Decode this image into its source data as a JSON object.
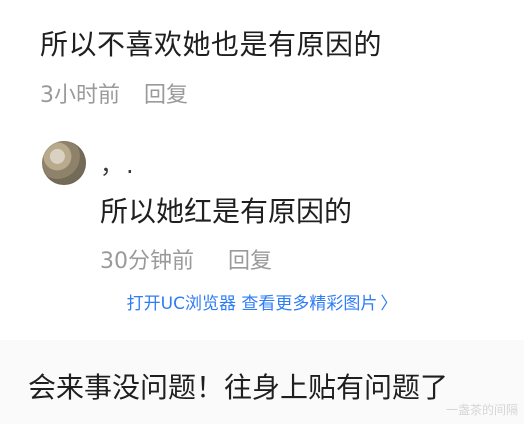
{
  "top_comment": {
    "text": "所以不喜欢她也是有原因的",
    "time": "3小时前",
    "reply_label": "回复"
  },
  "reply": {
    "username": "，.",
    "text": "所以她红是有原因的",
    "time": "30分钟前",
    "reply_label": "回复"
  },
  "uc_link": {
    "text": "打开UC浏览器 查看更多精彩图片",
    "chevron": "〉"
  },
  "bottom_comment": {
    "text": "会来事没问题！往身上贴有问题了"
  },
  "watermark": {
    "text": "一盏茶的间隔"
  },
  "icons": {
    "avatar": "avatar-image",
    "chevron": "chevron-right-icon"
  },
  "colors": {
    "primary_text": "#1f1f1f",
    "secondary_text": "#9a9a9a",
    "link": "#2f7df6",
    "background": "#ffffff"
  }
}
